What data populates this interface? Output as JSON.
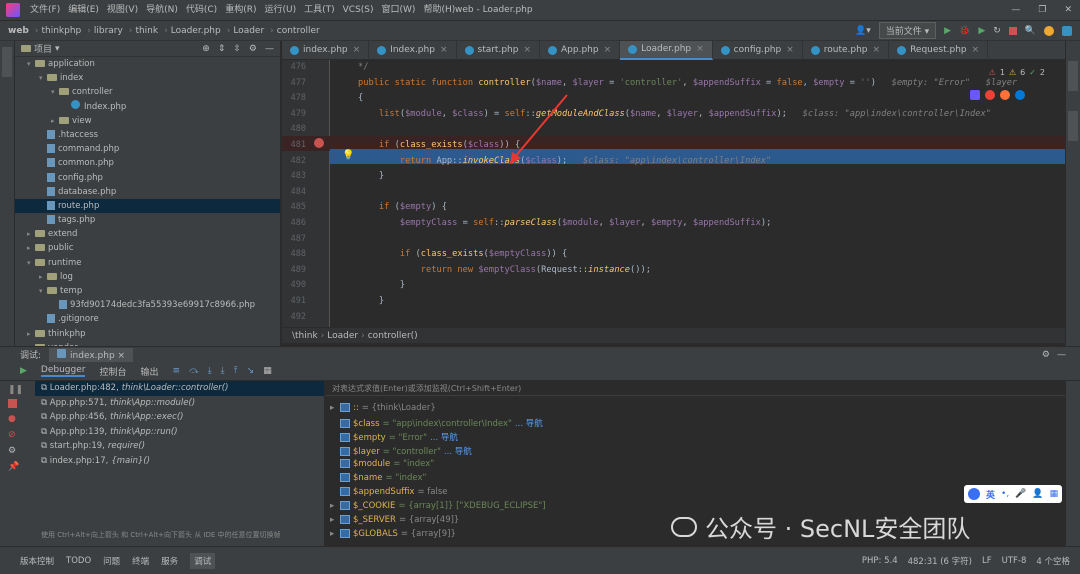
{
  "menu": [
    "文件(F)",
    "编辑(E)",
    "视图(V)",
    "导航(N)",
    "代码(C)",
    "重构(R)",
    "运行(U)",
    "工具(T)",
    "VCS(S)",
    "窗口(W)",
    "帮助(H)"
  ],
  "window_title": "web - Loader.php",
  "breadcrumb": [
    "web",
    "thinkphp",
    "library",
    "think",
    "Loader.php",
    "Loader",
    "controller"
  ],
  "run_config": "当前文件",
  "project": {
    "header": "项目",
    "items": [
      {
        "label": "application",
        "indent": 2,
        "type": "folder",
        "arrow": "▾"
      },
      {
        "label": "index",
        "indent": 3,
        "type": "folder",
        "arrow": "▾"
      },
      {
        "label": "controller",
        "indent": 4,
        "type": "folder",
        "arrow": "▾"
      },
      {
        "label": "Index.php",
        "indent": 5,
        "type": "class",
        "arrow": ""
      },
      {
        "label": "view",
        "indent": 4,
        "type": "folder",
        "arrow": "▸"
      },
      {
        "label": ".htaccess",
        "indent": 3,
        "type": "file",
        "arrow": ""
      },
      {
        "label": "command.php",
        "indent": 3,
        "type": "file",
        "arrow": ""
      },
      {
        "label": "common.php",
        "indent": 3,
        "type": "file",
        "arrow": ""
      },
      {
        "label": "config.php",
        "indent": 3,
        "type": "file",
        "arrow": ""
      },
      {
        "label": "database.php",
        "indent": 3,
        "type": "file",
        "arrow": ""
      },
      {
        "label": "route.php",
        "indent": 3,
        "type": "file",
        "arrow": "",
        "selected": true
      },
      {
        "label": "tags.php",
        "indent": 3,
        "type": "file",
        "arrow": ""
      },
      {
        "label": "extend",
        "indent": 2,
        "type": "folder",
        "arrow": "▸"
      },
      {
        "label": "public",
        "indent": 2,
        "type": "folder",
        "arrow": "▸"
      },
      {
        "label": "runtime",
        "indent": 2,
        "type": "folder",
        "arrow": "▾"
      },
      {
        "label": "log",
        "indent": 3,
        "type": "folder",
        "arrow": "▸"
      },
      {
        "label": "temp",
        "indent": 3,
        "type": "folder",
        "arrow": "▾"
      },
      {
        "label": "93fd90174dedc3fa55393e69917c8966.php",
        "indent": 4,
        "type": "file",
        "arrow": ""
      },
      {
        "label": ".gitignore",
        "indent": 3,
        "type": "file",
        "arrow": ""
      },
      {
        "label": "thinkphp",
        "indent": 2,
        "type": "folder",
        "arrow": "▸"
      },
      {
        "label": "vendor",
        "indent": 2,
        "type": "folder",
        "arrow": "▸"
      }
    ]
  },
  "tabs": [
    "index.php",
    "Index.php",
    "start.php",
    "App.php",
    "Loader.php",
    "config.php",
    "route.php",
    "Request.php"
  ],
  "active_tab": 4,
  "editor": {
    "lines": [
      {
        "n": "476",
        "html": "<span class='cm'>*/</span>"
      },
      {
        "n": "477",
        "html": "<span class='kw'>public static function </span><span class='fn'>controller</span>(<span class='var'>$name</span>, <span class='var'>$layer</span> = <span class='str'>'controller'</span>, <span class='var'>$appendSuffix</span> = <span class='kw'>false</span>, <span class='var'>$empty</span> = <span class='str'>''</span>)   <span class='cm it'>$empty: \"Error\"   $layer</span>"
      },
      {
        "n": "478",
        "html": "{"
      },
      {
        "n": "479",
        "html": "    <span class='kw'>list</span>(<span class='var'>$module</span>, <span class='var'>$class</span>) = <span class='kw'>self</span>::<span class='fn it'>getModuleAndClass</span>(<span class='var'>$name</span>, <span class='var'>$layer</span>, <span class='var'>$appendSuffix</span>);   <span class='cm it'>$class: \"app\\index\\controller\\Index\"</span>"
      },
      {
        "n": "480",
        "html": ""
      },
      {
        "n": "481",
        "html": "    <span class='kw'>if </span>(<span class='fn'>class_exists</span>(<span class='var'>$class</span>)) {"
      },
      {
        "n": "482",
        "html": "        <span class='kw'>return </span>App::<span class='fn it'>invokeClass</span>(<span class='var'>$class</span>);   <span class='cm it'>$class: \"app\\index\\controller\\Index\"</span>"
      },
      {
        "n": "483",
        "html": "    }"
      },
      {
        "n": "484",
        "html": ""
      },
      {
        "n": "485",
        "html": "    <span class='kw'>if </span>(<span class='var'>$empty</span>) {"
      },
      {
        "n": "486",
        "html": "        <span class='var'>$emptyClass</span> = <span class='kw'>self</span>::<span class='fn it'>parseClass</span>(<span class='var'>$module</span>, <span class='var'>$layer</span>, <span class='var'>$empty</span>, <span class='var'>$appendSuffix</span>);"
      },
      {
        "n": "487",
        "html": ""
      },
      {
        "n": "488",
        "html": "        <span class='kw'>if </span>(<span class='fn'>class_exists</span>(<span class='var'>$emptyClass</span>)) {"
      },
      {
        "n": "489",
        "html": "            <span class='kw'>return new </span><span class='var'>$emptyClass</span>(Request::<span class='fn it'>instance</span>());"
      },
      {
        "n": "490",
        "html": "        }"
      },
      {
        "n": "491",
        "html": "    }"
      },
      {
        "n": "492",
        "html": ""
      }
    ],
    "inspection_counts": [
      "1",
      "6",
      "2"
    ]
  },
  "editor_breadcrumb": [
    "\\think",
    "Loader",
    "controller()"
  ],
  "debug": {
    "label": "调试:",
    "tab": "index.php",
    "tool_tabs": [
      "Debugger",
      "控制台",
      "输出"
    ],
    "frames": [
      {
        "file": "Loader.php:482,",
        "sig": "think\\Loader::controller()",
        "selected": true
      },
      {
        "file": "App.php:571,",
        "sig": "think\\App::module()"
      },
      {
        "file": "App.php:456,",
        "sig": "think\\App::exec()"
      },
      {
        "file": "App.php:139,",
        "sig": "think\\App::run()"
      },
      {
        "file": "start.php:19,",
        "sig": "require()"
      },
      {
        "file": "index.php:17,",
        "sig": "{main}()"
      }
    ],
    "frames_hint": "使用 Ctrl+Alt+向上箭头 和 Ctrl+Alt+向下箭头 从 IDE 中的任意位置切换帧",
    "eval_placeholder": "对表达式求值(Enter)或添加监视(Ctrl+Shift+Enter)",
    "vars": [
      {
        "name": "::",
        "value": "= {think\\Loader}",
        "nav": "",
        "arrow": "▸"
      },
      {
        "name": "$class",
        "value": "= \"app\\index\\controller\\Index\"",
        "nav": "... 导航",
        "arrow": ""
      },
      {
        "name": "$empty",
        "value": "= \"Error\"",
        "nav": "... 导航",
        "arrow": ""
      },
      {
        "name": "$layer",
        "value": "= \"controller\"",
        "nav": "... 导航",
        "arrow": ""
      },
      {
        "name": "$module",
        "value": "= \"index\"",
        "nav": "",
        "arrow": ""
      },
      {
        "name": "$name",
        "value": "= \"index\"",
        "nav": "",
        "arrow": ""
      },
      {
        "name": "$appendSuffix",
        "value": "= false",
        "nav": "",
        "arrow": ""
      },
      {
        "name": "$_COOKIE",
        "value": "= {array[1]} [\"XDEBUG_ECLIPSE\"]",
        "nav": "",
        "arrow": "▸"
      },
      {
        "name": "$_SERVER",
        "value": "= {array[49]}",
        "nav": "",
        "arrow": "▸"
      },
      {
        "name": "$GLOBALS",
        "value": "= {array[9]}",
        "nav": "",
        "arrow": "▸"
      }
    ]
  },
  "statusbar": {
    "buttons": [
      "版本控制",
      "TODO",
      "问题",
      "终端",
      "服务",
      "调试"
    ],
    "right": [
      "PHP: 5.4",
      "482:31 (6 字符)",
      "LF",
      "UTF-8",
      "4 个空格"
    ]
  },
  "watermark": "公众号 · SecNL安全团队",
  "ime": {
    "label": "英"
  }
}
